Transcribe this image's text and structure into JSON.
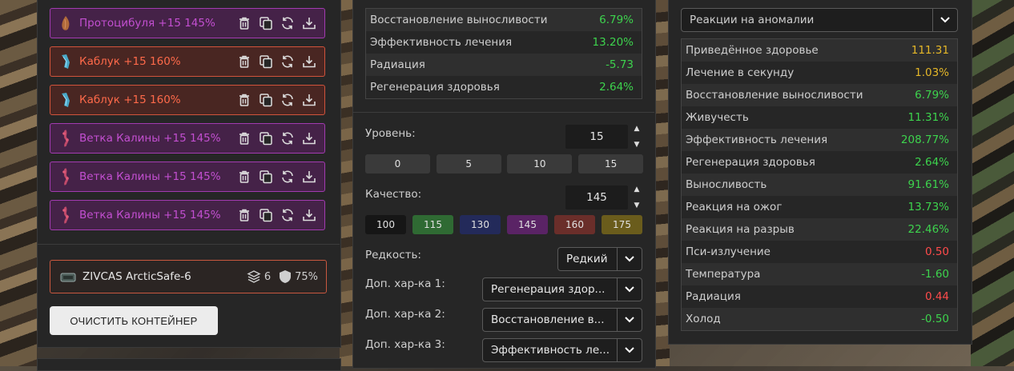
{
  "artifacts": [
    {
      "name": "Протоцибуля +15 145%",
      "color": "purple"
    },
    {
      "name": "Каблук +15 160%",
      "color": "red"
    },
    {
      "name": "Каблук +15 160%",
      "color": "red"
    },
    {
      "name": "Ветка Калины +15 145%",
      "color": "purple"
    },
    {
      "name": "Ветка Калины +15 145%",
      "color": "purple"
    },
    {
      "name": "Ветка Калины +15 145%",
      "color": "purple"
    }
  ],
  "artifact_actions": [
    "trash-icon",
    "copy-icon",
    "refresh-icon",
    "download-icon"
  ],
  "container": {
    "name": "ZIVCAS ArcticSafe-6",
    "slots": "6",
    "protection": "75%"
  },
  "clear_button": "ОЧИСТИТЬ КОНТЕЙНЕР",
  "mid_stats": [
    {
      "label": "Восстановление выносливости",
      "value": "6.79%",
      "color": "green"
    },
    {
      "label": "Эффективность лечения",
      "value": "13.20%",
      "color": "green"
    },
    {
      "label": "Радиация",
      "value": "-5.73",
      "color": "green"
    },
    {
      "label": "Регенерация здоровья",
      "value": "2.64%",
      "color": "green"
    }
  ],
  "level": {
    "label": "Уровень:",
    "value": "15",
    "presets": [
      "0",
      "5",
      "10",
      "15"
    ]
  },
  "quality": {
    "label": "Качество:",
    "value": "145",
    "presets": [
      {
        "label": "100",
        "bg": "#161616"
      },
      {
        "label": "115",
        "bg": "#2f6a33"
      },
      {
        "label": "130",
        "bg": "#232a5a"
      },
      {
        "label": "145",
        "bg": "#5a2365"
      },
      {
        "label": "160",
        "bg": "#6a2e2a"
      },
      {
        "label": "175",
        "bg": "#6a5c1c"
      }
    ]
  },
  "rarity": {
    "label": "Редкость:",
    "value": "Редкий"
  },
  "extra": [
    {
      "label": "Доп. хар-ка 1:",
      "value": "Регенерация здор..."
    },
    {
      "label": "Доп. хар-ка 2:",
      "value": "Восстановление в..."
    },
    {
      "label": "Доп. хар-ка 3:",
      "value": "Эффективность ле..."
    }
  ],
  "reaction_select": "Реакции на аномалии",
  "right_stats": [
    {
      "label": "Приведённое здоровье",
      "value": "111.31",
      "color": "yellow"
    },
    {
      "label": "Лечение в секунду",
      "value": "1.03%",
      "color": "yellow"
    },
    {
      "label": "Восстановление выносливости",
      "value": "6.79%",
      "color": "green"
    },
    {
      "label": "Живучесть",
      "value": "11.31%",
      "color": "green"
    },
    {
      "label": "Эффективность лечения",
      "value": "208.77%",
      "color": "green"
    },
    {
      "label": "Регенерация здоровья",
      "value": "2.64%",
      "color": "green"
    },
    {
      "label": "Выносливость",
      "value": "91.61%",
      "color": "green"
    },
    {
      "label": "Реакция на ожог",
      "value": "13.73%",
      "color": "green"
    },
    {
      "label": "Реакция на разрыв",
      "value": "22.46%",
      "color": "green"
    },
    {
      "label": "Пси-излучение",
      "value": "0.50",
      "color": "red"
    },
    {
      "label": "Температура",
      "value": "-1.60",
      "color": "green"
    },
    {
      "label": "Радиация",
      "value": "0.44",
      "color": "red"
    },
    {
      "label": "Холод",
      "value": "-0.50",
      "color": "green"
    }
  ]
}
